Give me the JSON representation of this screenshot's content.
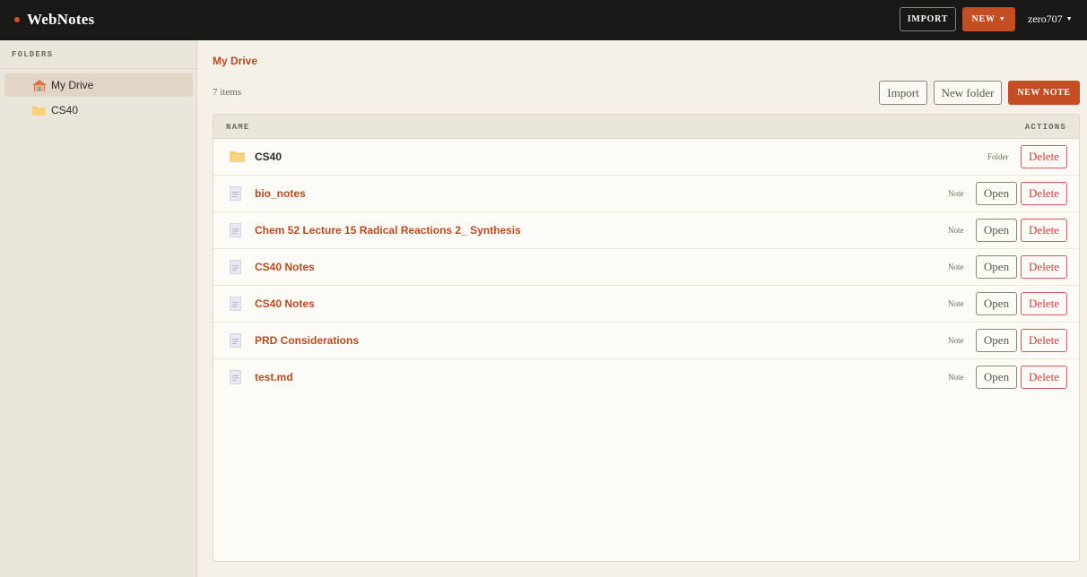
{
  "app": {
    "brand": "WebNotes"
  },
  "topbar": {
    "import_label": "IMPORT",
    "new_label": "NEW",
    "user_name": "zero707"
  },
  "sidebar": {
    "heading": "FOLDERS",
    "items": [
      {
        "label": "My Drive",
        "icon": "home-icon",
        "active": true
      },
      {
        "label": "CS40",
        "icon": "folder-icon",
        "active": false
      }
    ]
  },
  "main": {
    "breadcrumb": "My Drive",
    "item_count": "7 items",
    "import_label": "Import",
    "new_folder_label": "New folder",
    "new_note_label": "NEW NOTE",
    "table": {
      "col_name": "NAME",
      "col_actions": "ACTIONS",
      "open_label": "Open",
      "delete_label": "Delete",
      "rows": [
        {
          "name": "CS40",
          "type": "Folder",
          "kind": "folder"
        },
        {
          "name": "bio_notes",
          "type": "Note",
          "kind": "note"
        },
        {
          "name": "Chem 52 Lecture 15 Radical Reactions 2_ Synthesis",
          "type": "Note",
          "kind": "note"
        },
        {
          "name": "CS40 Notes",
          "type": "Note",
          "kind": "note"
        },
        {
          "name": "CS40 Notes",
          "type": "Note",
          "kind": "note"
        },
        {
          "name": "PRD Considerations",
          "type": "Note",
          "kind": "note"
        },
        {
          "name": "test.md",
          "type": "Note",
          "kind": "note"
        }
      ]
    }
  },
  "colors": {
    "accent": "#c44e24",
    "topbar": "#1a1816",
    "danger": "#c73d3d"
  }
}
